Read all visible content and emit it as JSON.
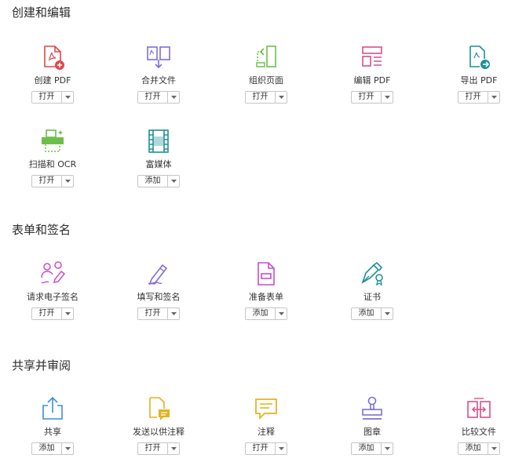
{
  "sections": [
    {
      "title": "创建和编辑",
      "tools": [
        {
          "label": "创建 PDF",
          "action": "打开",
          "icon": "create-pdf-icon"
        },
        {
          "label": "合并文件",
          "action": "打开",
          "icon": "combine-files-icon"
        },
        {
          "label": "组织页面",
          "action": "打开",
          "icon": "organize-pages-icon"
        },
        {
          "label": "编辑 PDF",
          "action": "打开",
          "icon": "edit-pdf-icon"
        },
        {
          "label": "导出 PDF",
          "action": "打开",
          "icon": "export-pdf-icon"
        },
        {
          "label": "扫描和 OCR",
          "action": "打开",
          "icon": "scan-ocr-icon"
        },
        {
          "label": "富媒体",
          "action": "添加",
          "icon": "rich-media-icon"
        }
      ]
    },
    {
      "title": "表单和签名",
      "tools": [
        {
          "label": "请求电子签名",
          "action": "打开",
          "icon": "request-esign-icon"
        },
        {
          "label": "填写和签名",
          "action": "打开",
          "icon": "fill-sign-icon"
        },
        {
          "label": "准备表单",
          "action": "添加",
          "icon": "prepare-form-icon"
        },
        {
          "label": "证书",
          "action": "添加",
          "icon": "certificates-icon"
        }
      ]
    },
    {
      "title": "共享并审阅",
      "tools": [
        {
          "label": "共享",
          "action": "添加",
          "icon": "share-icon"
        },
        {
          "label": "发送以供注释",
          "action": "打开",
          "icon": "send-for-comments-icon"
        },
        {
          "label": "注释",
          "action": "打开",
          "icon": "comment-icon"
        },
        {
          "label": "图章",
          "action": "添加",
          "icon": "stamp-icon"
        },
        {
          "label": "比较文件",
          "action": "添加",
          "icon": "compare-files-icon"
        }
      ]
    }
  ],
  "colors": {
    "red": "#e0474c",
    "purple_blue": "#7c6fd6",
    "green": "#6cbf4a",
    "pink": "#d94f8c",
    "teal": "#1d8f96",
    "magenta": "#c64fc9",
    "blue": "#3a8fd6",
    "yellow": "#e3b21c"
  }
}
